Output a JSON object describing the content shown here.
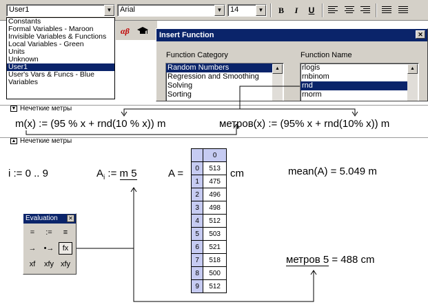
{
  "toolbar": {
    "style_value": "User1",
    "font_value": "Arial",
    "size_value": "14",
    "bold": "B",
    "italic": "I",
    "underline": "U"
  },
  "style_list": {
    "items": [
      "Constants",
      "Formal Variables - Maroon",
      "Invisible Variables & Functions",
      "Local Variables - Green",
      "Units",
      "Unknown",
      "User1",
      "User's Vars & Funcs - Blue",
      "Variables"
    ],
    "selected_index": 6
  },
  "greek_icon": "αβ",
  "dialog": {
    "title": "Insert Function",
    "category_label": "Function Category",
    "name_label": "Function Name",
    "categories": [
      "Random Numbers",
      "Regression and Smoothing",
      "Solving",
      "Sorting"
    ],
    "selected_category": 0,
    "names": [
      "rlogis",
      "rnbinom",
      "rnd",
      "rnorm"
    ],
    "selected_name": 2
  },
  "worksheet": {
    "region_label_top": "Нечеткие метры",
    "region_label_bottom": "Нечеткие метры",
    "def_m": {
      "lhs": "m(x)",
      "assign": ":=",
      "expr_a": "(95  %  x + ",
      "rnd": "rnd",
      "expr_b": "(10  %  x))",
      "unit": "m"
    },
    "def_metrov": {
      "lhs": "метров(x)",
      "assign": ":=",
      "expr_a": "(95% x + ",
      "rnd": "rnd",
      "expr_b": "(10% x))",
      "unit": "m"
    },
    "range_def": "i := 0 .. 9",
    "a_def_lhs": "A",
    "a_def_sub": "i",
    "a_def_rhs": "m 5",
    "a_assign": ":=",
    "matrix_lhs": "A =",
    "matrix_col_header": "0",
    "matrix_rows": [
      {
        "idx": "0",
        "val": "513"
      },
      {
        "idx": "1",
        "val": "475"
      },
      {
        "idx": "2",
        "val": "496"
      },
      {
        "idx": "3",
        "val": "498"
      },
      {
        "idx": "4",
        "val": "512"
      },
      {
        "idx": "5",
        "val": "503"
      },
      {
        "idx": "6",
        "val": "521"
      },
      {
        "idx": "7",
        "val": "518"
      },
      {
        "idx": "8",
        "val": "500"
      },
      {
        "idx": "9",
        "val": "512"
      }
    ],
    "matrix_unit": "cm",
    "mean_expr": "mean(A) = 5.049",
    "mean_unit": "m",
    "metrov_eval_lhs": "метров 5",
    "metrov_eval_rhs": "= 488",
    "metrov_eval_unit": "cm"
  },
  "eval_toolbar": {
    "title": "Evaluation",
    "buttons": [
      "=",
      ":=",
      "≡",
      "→",
      "•→",
      "fx",
      "xf",
      "xfy",
      "xfy"
    ]
  },
  "colors": {
    "title_bar": "#0a246a",
    "face": "#d4d0c8",
    "matrix_index": "#c6cbf2"
  }
}
